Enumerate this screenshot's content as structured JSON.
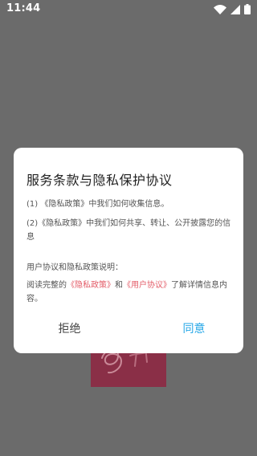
{
  "status_bar": {
    "time": "11:44",
    "icons": [
      "wifi-icon",
      "cellular-signal-icon",
      "battery-icon"
    ],
    "color": "#ffffff"
  },
  "background": {
    "overlay_color": "#6b6b6b",
    "logo_color": "#8a2f47",
    "logo_icon": "app-logo-icon"
  },
  "dialog": {
    "title": "服务条款与隐私保护协议",
    "items": [
      {
        "prefix": "(1) ",
        "link": "《隐私政策》",
        "suffix": "中我们如何收集信息。"
      },
      {
        "prefix": "(2)",
        "link": "《隐私政策》",
        "suffix": "中我们如何共享、转让、公开披露您的信息"
      }
    ],
    "notice": {
      "title": "用户协议和隐私政策说明：",
      "prefix": "阅读完整的",
      "privacy_link": "《隐私政策》",
      "middle": "和",
      "user_link": "《用户协议》",
      "suffix": "了解详情信息内容。"
    },
    "buttons": {
      "reject": "拒绝",
      "agree": "同意"
    },
    "colors": {
      "link": "#e35b67",
      "agree": "#26a7e7",
      "text": "#555555",
      "title": "#222222"
    }
  }
}
